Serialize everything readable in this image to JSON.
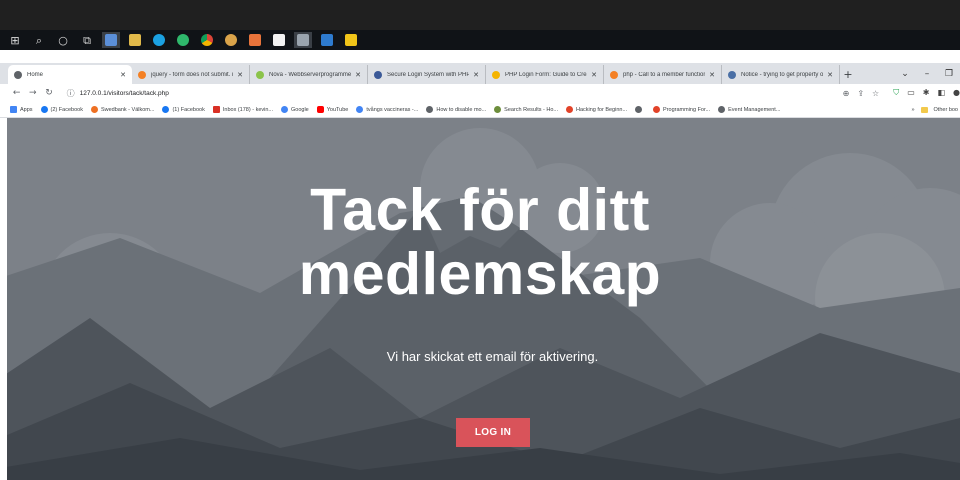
{
  "taskbar": {
    "icons": [
      "windows-start-icon",
      "search-icon",
      "cortana-icon",
      "task-view-icon",
      "app-icon",
      "app-icon",
      "edge-icon",
      "app-icon",
      "chrome-icon",
      "app-icon",
      "app-icon",
      "app-icon",
      "app-icon",
      "app-icon",
      "app-icon"
    ]
  },
  "tabs": [
    {
      "label": "Home",
      "active": true,
      "color": "#5f6368"
    },
    {
      "label": "jquery - form does not submit. i",
      "active": false,
      "color": "#f48024"
    },
    {
      "label": "Nova - Webbserverprogramme",
      "active": false,
      "color": "#8bc34a"
    },
    {
      "label": "Secure Login System with PHP a",
      "active": false,
      "color": "#3b5998"
    },
    {
      "label": "PHP Login Form: Guide to Creat",
      "active": false,
      "color": "#f5b400"
    },
    {
      "label": "php - Call to a member function",
      "active": false,
      "color": "#f48024"
    },
    {
      "label": "Notice - trying to get property o",
      "active": false,
      "color": "#4a6fa5"
    }
  ],
  "address": {
    "url": "127.0.0.1/visitors/tack/tack.php"
  },
  "bookmarks": [
    {
      "label": "Apps",
      "color": "#4285f4"
    },
    {
      "label": "(2) Facebook",
      "color": "#1877f2"
    },
    {
      "label": "Swedbank - Välkom...",
      "color": "#ee7023"
    },
    {
      "label": "(1) Facebook",
      "color": "#1877f2"
    },
    {
      "label": "Inbox (178) - kevin...",
      "color": "#d93025"
    },
    {
      "label": "Google",
      "color": "#4285f4"
    },
    {
      "label": "YouTube",
      "color": "#ff0000"
    },
    {
      "label": "tvångs vaccineras -...",
      "color": "#4285f4"
    },
    {
      "label": "How to disable mo...",
      "color": "#5f6368"
    },
    {
      "label": "Search Results - Ho...",
      "color": "#6d8e3c"
    },
    {
      "label": "Hacking for Beginn...",
      "color": "#e24329"
    },
    {
      "label": "",
      "color": "#5f6368"
    },
    {
      "label": "Programming For...",
      "color": "#e24329"
    },
    {
      "label": "Event Management...",
      "color": "#5f6368"
    }
  ],
  "bookmarks_other": "Other boo",
  "page": {
    "title_line1": "Tack för ditt",
    "title_line2": "medlemskap",
    "subtitle": "Vi har skickat ett email för aktivering.",
    "login_label": "LOG IN"
  },
  "colors": {
    "login_button": "#d9535a",
    "hero_background": "#7b8087"
  }
}
